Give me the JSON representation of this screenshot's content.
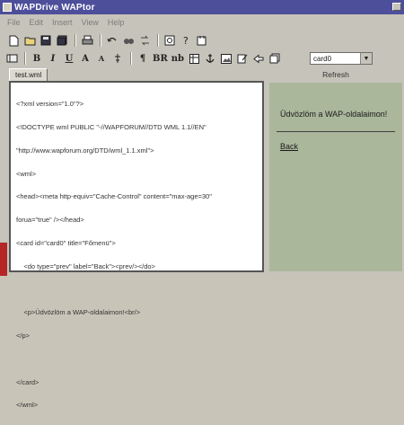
{
  "window": {
    "title": "WAPDrive WAPtor"
  },
  "menu": [
    "File",
    "Edit",
    "Insert",
    "View",
    "Help"
  ],
  "toolbar1": [
    {
      "name": "new-file-icon"
    },
    {
      "name": "open-folder-icon"
    },
    {
      "name": "save-icon"
    },
    {
      "name": "save-all-icon"
    },
    {
      "name": "print-icon"
    },
    {
      "name": "undo-icon"
    },
    {
      "name": "find-icon"
    },
    {
      "name": "replace-icon"
    },
    {
      "name": "preview-icon"
    },
    {
      "name": "help-icon"
    },
    {
      "name": "run-icon"
    }
  ],
  "toolbar2": {
    "bold": "B",
    "italic": "I",
    "underline": "U",
    "font_size_up": "A",
    "font_size_down": "A",
    "paragraph": "¶",
    "br": "BR",
    "nb": "nb",
    "card_select": "card0"
  },
  "tabs": [
    "test.wml"
  ],
  "editor_lines": [
    "<?xml version=\"1.0\"?>",
    "<!DOCTYPE wml PUBLIC \"-//WAPFORUM//DTD WML 1.1//EN\"",
    "\"http://www.wapforum.org/DTD/wml_1.1.xml\">",
    "<wml>",
    "<head><meta http-equiv=\"Cache-Control\" content=\"max-age=30\"",
    "forua=\"true\" /></head>",
    "<card id=\"card0\" title=\"Főmenü\">",
    "    <do type=\"prev\" label=\"Back\"><prev/></do>",
    "",
    "    <p>Üdvözlöm a WAP-oldalaimon!<br/>",
    "</p>",
    "",
    "</card>",
    "</wml>"
  ],
  "preview": {
    "header": "Refresh",
    "text": "Üdvözlöm a WAP-oldalaimon!",
    "link": "Back"
  }
}
